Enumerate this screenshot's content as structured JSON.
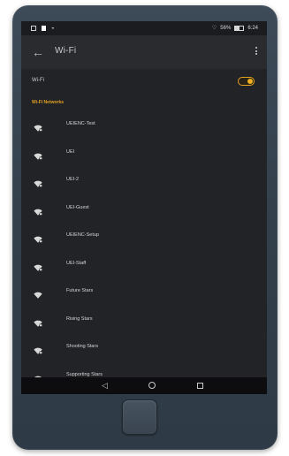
{
  "status_bar": {
    "battery_text": "56%",
    "time": "6:24"
  },
  "app_bar": {
    "title": "Wi-Fi",
    "back_icon": "arrow-back-icon",
    "menu_icon": "overflow-menu-icon"
  },
  "wifi_toggle": {
    "label": "Wi-Fi",
    "state": "on",
    "accent_color": "#e0a020"
  },
  "networks_section": {
    "header": "Wi-Fi Networks",
    "items": [
      {
        "ssid": "UEIENC-Test",
        "secured": true
      },
      {
        "ssid": "UEI",
        "secured": true
      },
      {
        "ssid": "UEI-2",
        "secured": true
      },
      {
        "ssid": "UEI-Guest",
        "secured": true
      },
      {
        "ssid": "UEIENC-Setup",
        "secured": true
      },
      {
        "ssid": "UEI-Staff",
        "secured": true
      },
      {
        "ssid": "Future Stars",
        "secured": false
      },
      {
        "ssid": "Rising Stars",
        "secured": true
      },
      {
        "ssid": "Shooting Stars",
        "secured": true
      },
      {
        "ssid": "Supporting Stars",
        "secured": true
      }
    ]
  },
  "nav_bar": {
    "back_icon": "triangle-back-icon",
    "home_icon": "circle-home-icon",
    "recents_icon": "square-recents-icon"
  }
}
